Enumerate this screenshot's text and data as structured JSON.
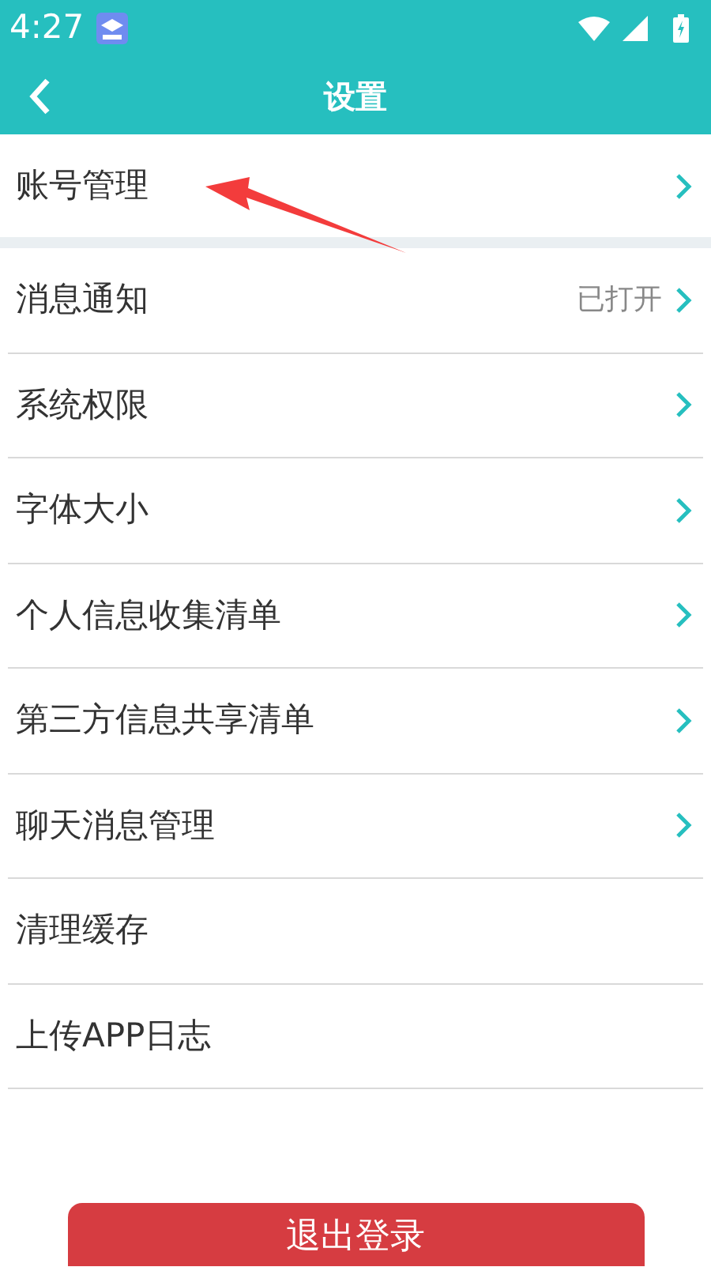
{
  "status_bar": {
    "time": "4:27"
  },
  "header": {
    "title": "设置"
  },
  "groups": [
    {
      "items": [
        {
          "label": "账号管理",
          "kind": "link"
        }
      ]
    },
    {
      "items": [
        {
          "label": "消息通知",
          "value": "已打开",
          "kind": "link"
        },
        {
          "label": "系统权限",
          "kind": "link"
        },
        {
          "label": "字体大小",
          "kind": "link"
        },
        {
          "label": "个人信息收集清单",
          "kind": "link"
        },
        {
          "label": "第三方信息共享清单",
          "kind": "link"
        },
        {
          "label": "聊天消息管理",
          "kind": "link"
        },
        {
          "label": "清理缓存",
          "kind": "plain"
        },
        {
          "label": "上传APP日志",
          "kind": "plain"
        }
      ]
    }
  ],
  "logout_button": {
    "label": "退出登录"
  }
}
